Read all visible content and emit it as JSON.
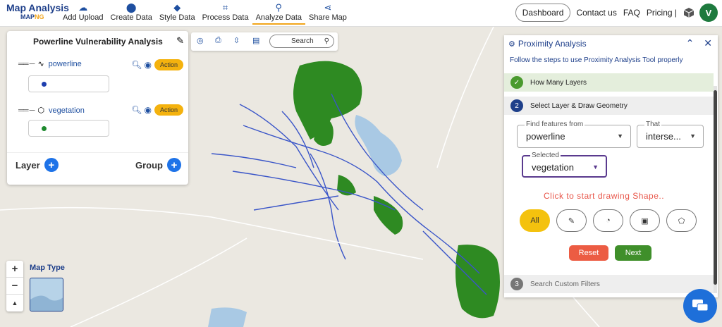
{
  "brand": {
    "line1": "Map Analysis",
    "line2_a": "MAP",
    "line2_b": "NG"
  },
  "nav": [
    {
      "label": "Add Upload",
      "icon": "cloud-upload-icon"
    },
    {
      "label": "Create Data",
      "icon": "map-pin-icon"
    },
    {
      "label": "Style Data",
      "icon": "paint-bucket-icon"
    },
    {
      "label": "Process Data",
      "icon": "process-icon"
    },
    {
      "label": "Analyze Data",
      "icon": "analyze-icon",
      "active": true
    },
    {
      "label": "Share Map",
      "icon": "share-icon"
    }
  ],
  "right_nav": {
    "dashboard": "Dashboard",
    "contact": "Contact us",
    "faq": "FAQ",
    "pricing": "Pricing |",
    "avatar": "V"
  },
  "layer_panel": {
    "title": "Powerline Vulnerability Analysis",
    "layers": [
      {
        "name": "powerline",
        "action": "Action",
        "color": "#1e3fae"
      },
      {
        "name": "vegetation",
        "action": "Action",
        "color": "#1e8a2e"
      }
    ],
    "layer_label": "Layer",
    "group_label": "Group"
  },
  "toolbar": {
    "search_label": "Search"
  },
  "map_type": {
    "label": "Map Type"
  },
  "zoom": {
    "in": "+",
    "out": "−",
    "north": "▲"
  },
  "proximity": {
    "title": "Proximity Analysis",
    "subtitle": "Follow the steps to use Proximity Analysis Tool properly",
    "steps": [
      {
        "num": "✓",
        "label": "How Many Layers",
        "state": "done"
      },
      {
        "num": "2",
        "label": "Select Layer & Draw Geometry",
        "state": "active"
      },
      {
        "num": "3",
        "label": "Search Custom Filters",
        "state": "pending"
      }
    ],
    "find_features": {
      "label": "Find features from",
      "value": "powerline"
    },
    "that": {
      "label": "That",
      "value": "interse..."
    },
    "selected": {
      "label": "Selected",
      "value": "vegetation"
    },
    "click_text": "Click to start drawing Shape..",
    "shape_all": "All",
    "reset": "Reset",
    "next": "Next"
  },
  "colors": {
    "primary": "#1e3f8a",
    "accent": "#f4b20e",
    "green": "#3f8f2a",
    "red": "#ec5c43",
    "map_green": "#2e8a22",
    "map_blue": "#3a55c8"
  }
}
